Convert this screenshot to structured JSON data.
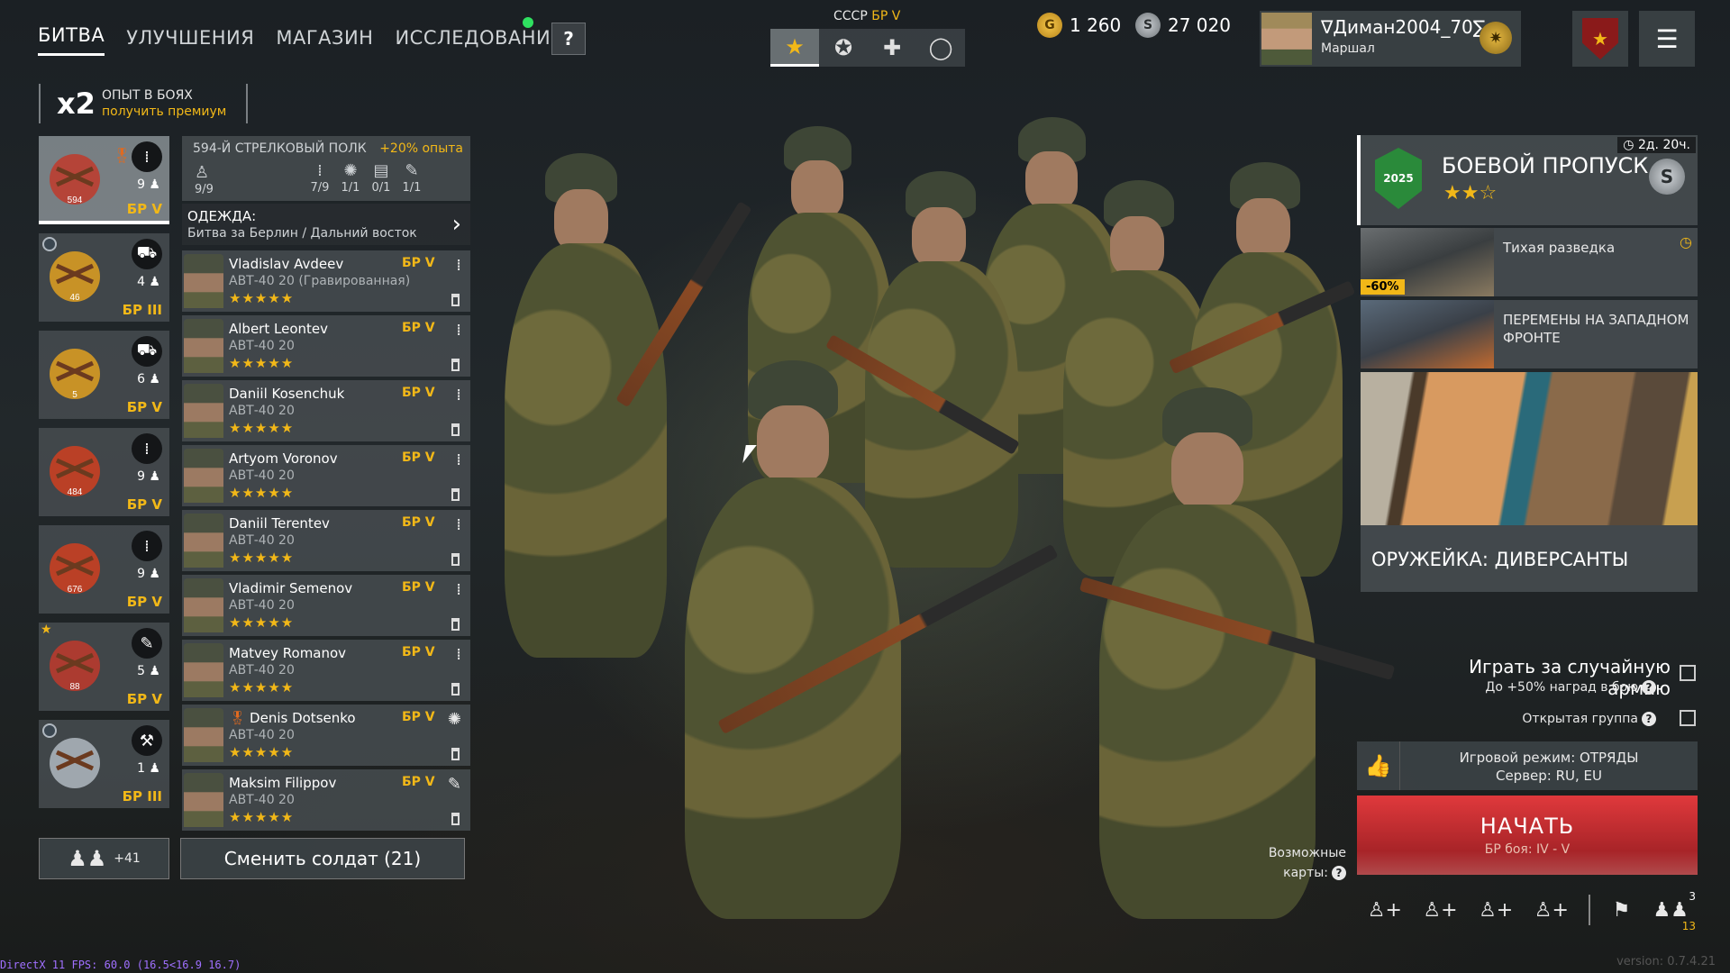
{
  "nav": {
    "tabs": [
      "БИТВА",
      "УЛУЧШЕНИЯ",
      "МАГАЗИН",
      "ИССЛЕДОВАНИЯ"
    ],
    "help_label": "?"
  },
  "xp": {
    "multiplier": "x2",
    "title": "ОПЫТ В БОЯХ",
    "subtitle": "получить премиум"
  },
  "army": {
    "label": "СССР",
    "br": "БР V",
    "tabs": [
      {
        "icon": "soviet-star-icon",
        "glyph": "★"
      },
      {
        "icon": "allied-star-icon",
        "glyph": "✪"
      },
      {
        "icon": "iron-cross-icon",
        "glyph": "✚"
      },
      {
        "icon": "ring-icon",
        "glyph": "◯"
      }
    ]
  },
  "currency": {
    "gold": "1 260",
    "gold_glyph": "G",
    "silver": "27 020",
    "silver_glyph": "S"
  },
  "profile": {
    "username": "∇Диман2004_70∑",
    "rank": "Маршал"
  },
  "squads": [
    {
      "count": "9",
      "br": "БР V",
      "role_glyph": "⁞",
      "active": true,
      "emblem_num": "594",
      "emblem_color": "#c0392b"
    },
    {
      "count": "4",
      "br": "БР III",
      "role_glyph": "⛟",
      "active": false,
      "emblem_num": "46",
      "emblem_color": "#e0a020"
    },
    {
      "count": "6",
      "br": "БР V",
      "role_glyph": "⛟",
      "active": false,
      "emblem_num": "5",
      "emblem_color": "#e0a020"
    },
    {
      "count": "9",
      "br": "БР V",
      "role_glyph": "⁞",
      "active": false,
      "emblem_num": "484",
      "emblem_color": "#d04020"
    },
    {
      "count": "9",
      "br": "БР V",
      "role_glyph": "⁞",
      "active": false,
      "emblem_num": "676",
      "emblem_color": "#d04020"
    },
    {
      "count": "5",
      "br": "БР V",
      "role_glyph": "✎",
      "active": false,
      "emblem_num": "88",
      "emblem_color": "#c0392b"
    },
    {
      "count": "1",
      "br": "БР III",
      "role_glyph": "⚒",
      "active": false,
      "emblem_num": "",
      "emblem_color": "#b0b8c0"
    }
  ],
  "squad_header": {
    "regiment": "594-Й СТРЕЛКОВЫЙ ПОЛК",
    "bonus": "+20% опыта",
    "size": "9/9",
    "stats": [
      {
        "glyph": "⁞",
        "value": "7/9"
      },
      {
        "glyph": "✺",
        "value": "1/1"
      },
      {
        "glyph": "▤",
        "value": "0/1"
      },
      {
        "glyph": "✎",
        "value": "1/1"
      }
    ]
  },
  "outfit": {
    "title": "ОДЕЖДА:",
    "value": "Битва за Берлин / Дальний восток"
  },
  "soldiers": [
    {
      "name": "Vladislav Avdeev",
      "weapon": "АВТ-40 20 (Гравированная)",
      "br": "БР V",
      "stars": "★★★★★",
      "class_glyph": "⁞",
      "medal": ""
    },
    {
      "name": "Albert Leontev",
      "weapon": "АВТ-40 20",
      "br": "БР V",
      "stars": "★★★★★",
      "class_glyph": "⁞",
      "medal": ""
    },
    {
      "name": "Daniil Kosenchuk",
      "weapon": "АВТ-40 20",
      "br": "БР V",
      "stars": "★★★★★",
      "class_glyph": "⁞",
      "medal": ""
    },
    {
      "name": "Artyom Voronov",
      "weapon": "АВТ-40 20",
      "br": "БР V",
      "stars": "★★★★★",
      "class_glyph": "⁞",
      "medal": ""
    },
    {
      "name": "Daniil Terentev",
      "weapon": "АВТ-40 20",
      "br": "БР V",
      "stars": "★★★★★",
      "class_glyph": "⁞",
      "medal": ""
    },
    {
      "name": "Vladimir Semenov",
      "weapon": "АВТ-40 20",
      "br": "БР V",
      "stars": "★★★★★",
      "class_glyph": "⁞",
      "medal": ""
    },
    {
      "name": "Matvey Romanov",
      "weapon": "АВТ-40 20",
      "br": "БР V",
      "stars": "★★★★★",
      "class_glyph": "⁞",
      "medal": ""
    },
    {
      "name": "Denis Dotsenko",
      "weapon": "АВТ-40 20",
      "br": "БР V",
      "stars": "★★★★★",
      "class_glyph": "✺",
      "medal": "🎖"
    },
    {
      "name": "Maksim Filippov",
      "weapon": "АВТ-40 20",
      "br": "БР V",
      "stars": "★★★★★",
      "class_glyph": "✎",
      "medal": ""
    }
  ],
  "bottom_left": {
    "members_count": "+41",
    "change_soldiers": "Сменить солдат (21)"
  },
  "battlepass": {
    "title": "БОЕВОЙ ПРОПУСК",
    "stars": "★★☆",
    "timer": "2д. 20ч.",
    "emblem_text": "2025",
    "silver_glyph": "S"
  },
  "events": [
    {
      "title": "Тихая разведка",
      "discount": "-60%"
    },
    {
      "title": "ПЕРЕМЕНЫ НА ЗАПАДНОМ ФРОНТЕ"
    }
  ],
  "armory": {
    "title": "ОРУЖЕЙКА: ДИВЕРСАНТЫ"
  },
  "play": {
    "random_army": "Играть за случайную армию",
    "random_bonus": "До +50% наград в бою",
    "open_group": "Открытая группа",
    "mode_line1": "Игровой режим: ОТРЯДЫ",
    "mode_line2": "Сервер: RU, EU",
    "start_label": "НАЧАТЬ",
    "start_br": "БР боя: IV - V",
    "maps_label": "Возможные карты:"
  },
  "group": {
    "friends_top": "3",
    "friends_bottom": "13"
  },
  "footer": {
    "fps": "DirectX 11 FPS: 60.0 (16.5<16.9 16.7)",
    "version": "version: 0.7.4.21"
  }
}
